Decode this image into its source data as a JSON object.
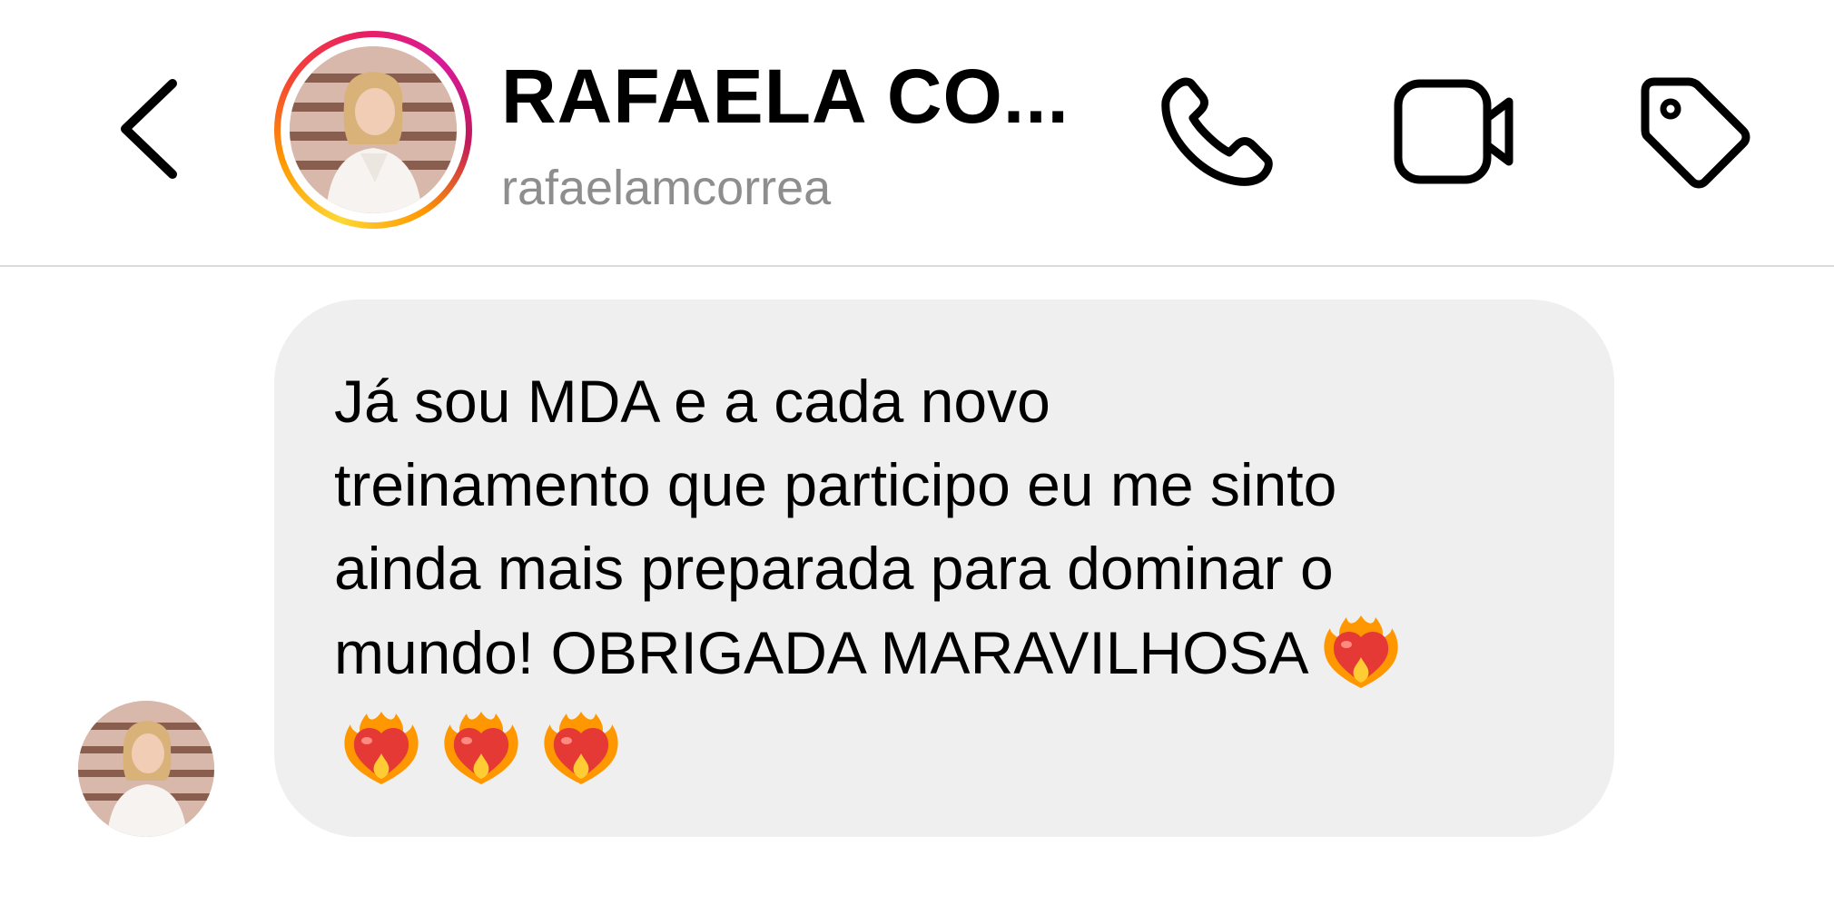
{
  "header": {
    "back_icon": "chevron-left-icon",
    "contact_name": "RAFAELA CO...",
    "username": "rafaelamcorrea",
    "actions": [
      {
        "name": "call",
        "icon": "phone-icon"
      },
      {
        "name": "video",
        "icon": "video-camera-icon"
      },
      {
        "name": "tag",
        "icon": "tag-icon"
      }
    ]
  },
  "colors": {
    "bubble_background": "#efefef",
    "divider": "#dbdbdb",
    "username_text": "#8e8e8e",
    "story_ring_gradient": [
      "#fdd835",
      "#ff9800",
      "#e91e63",
      "#c2185b"
    ]
  },
  "conversation": {
    "messages": [
      {
        "sender": "rafaelamcorrea",
        "text": "Já sou MDA e a cada novo\ntreinamento que participo eu me sinto\nainda mais preparada para dominar o\nmundo! OBRIGADA MARAVILHOSA",
        "emojis": [
          "heart-on-fire",
          "heart-on-fire",
          "heart-on-fire",
          "heart-on-fire"
        ]
      }
    ]
  }
}
